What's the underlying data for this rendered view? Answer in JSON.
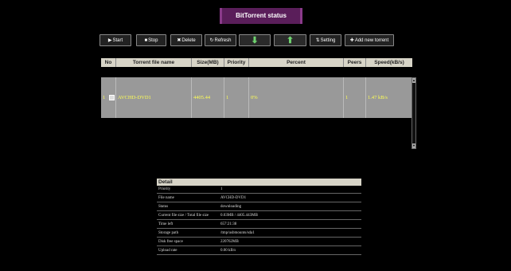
{
  "title": "BitTorrent status",
  "toolbar": {
    "start": "Start",
    "stop": "Stop",
    "delete": "Delete",
    "refresh": "Refresh",
    "setting": "Setting",
    "add": "Add new torrent"
  },
  "table": {
    "headers": [
      "No",
      "Torrent file name",
      "Size(MB)",
      "Priority",
      "Percent",
      "Peers",
      "Speed(kB/s)"
    ],
    "rows": [
      {
        "no": "1",
        "name": "AVCHD-DVD1",
        "size": "4405.44",
        "priority": "1",
        "percent": "0%",
        "peers": "1",
        "speed": "1.47 kB/s"
      }
    ]
  },
  "detail": {
    "heading": "Detail",
    "rows": [
      {
        "label": "Priority",
        "value": "1"
      },
      {
        "label": "File name",
        "value": "AVCHD-DVD1"
      },
      {
        "label": "Status",
        "value": "downloading"
      },
      {
        "label": "Current file size / Total file size",
        "value": "0.03MB / 4405.443MB"
      },
      {
        "label": "Time left",
        "value": "657:21:38"
      },
      {
        "label": "Storage path",
        "value": "/tmp/usbmounts/sda1"
      },
      {
        "label": "Disk free space",
        "value": "220762MB"
      },
      {
        "label": "Upload rate",
        "value": "0.00 kB/s"
      }
    ]
  }
}
